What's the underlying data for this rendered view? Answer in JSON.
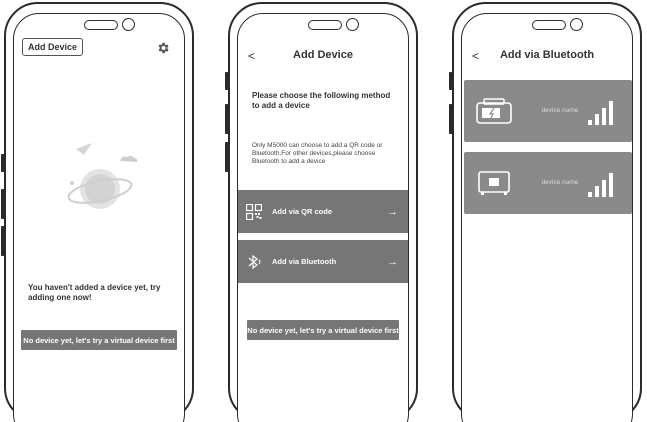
{
  "colors": {
    "button_grey": "#767676",
    "card_grey": "#8a8a8a",
    "outline": "#2b2b2b"
  },
  "screen1": {
    "add_device_label": "Add Device",
    "settings_icon": "gear-icon",
    "empty_message": "You haven't added a device yet, try adding one now!",
    "virtual_button": "No device yet, let's try a virtual device first"
  },
  "screen2": {
    "back_label": "<",
    "title": "Add Device",
    "heading": "Please choose the following method to add a device",
    "note": "Only M5000 can choose to add a QR code or Bluetooth.For other devices,please choose Bluetooth to add a device",
    "methods": [
      {
        "icon": "qr-code-icon",
        "label": "Add via QR code",
        "arrow": "→"
      },
      {
        "icon": "bluetooth-icon",
        "label": "Add via Bluetooth",
        "arrow": "→"
      }
    ],
    "virtual_button": "No device yet, let's try a virtual device first"
  },
  "screen3": {
    "back_label": "<",
    "title": "Add via Bluetooth",
    "devices": [
      {
        "icon": "portable-power-station-icon",
        "name": "device name",
        "signal_icon": "signal-strength-icon"
      },
      {
        "icon": "power-unit-icon",
        "name": "device name",
        "signal_icon": "signal-strength-icon"
      }
    ]
  }
}
